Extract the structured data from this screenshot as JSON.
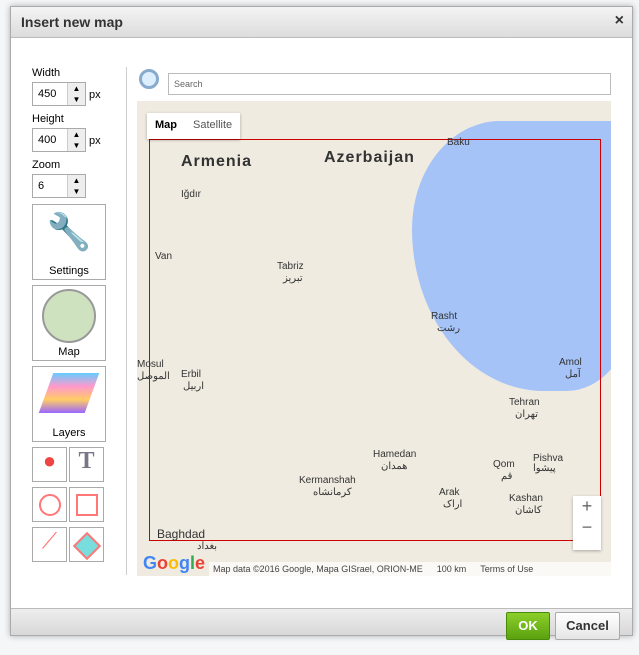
{
  "dialog": {
    "title": "Insert new map",
    "close": "×"
  },
  "fields": {
    "width_label": "Width",
    "width_value": "450",
    "height_label": "Height",
    "height_value": "400",
    "zoom_label": "Zoom",
    "zoom_value": "6",
    "unit": "px"
  },
  "tools": {
    "settings": "Settings",
    "map": "Map",
    "layers": "Layers"
  },
  "search": {
    "placeholder": "Search"
  },
  "map": {
    "tabs": [
      "Map",
      "Satellite"
    ],
    "countries": [
      "Armenia",
      "Azerbaijan"
    ],
    "cities": [
      "Baku",
      "Iğdır",
      "Van",
      "Tabriz",
      "تبریز",
      "Rasht",
      "رشت",
      "Mosul",
      "الموصل",
      "Erbil",
      "اربيل",
      "Amol",
      "آمل",
      "Tehran",
      "تهران",
      "Hamedan",
      "همدان",
      "Qom",
      "قم",
      "Pishva",
      "پیشوا",
      "Kermanshah",
      "کرمانشاه",
      "Arak",
      "اراک",
      "Kashan",
      "کاشان",
      "Baghdad",
      "بغداد"
    ],
    "zoom_in": "+",
    "zoom_out": "−",
    "attribution": "Map data ©2016 Google, Mapa GISrael, ORION-ME",
    "scale": "100 km",
    "terms": "Terms of Use",
    "logo": "Google"
  },
  "footer": {
    "ok": "OK",
    "cancel": "Cancel"
  }
}
